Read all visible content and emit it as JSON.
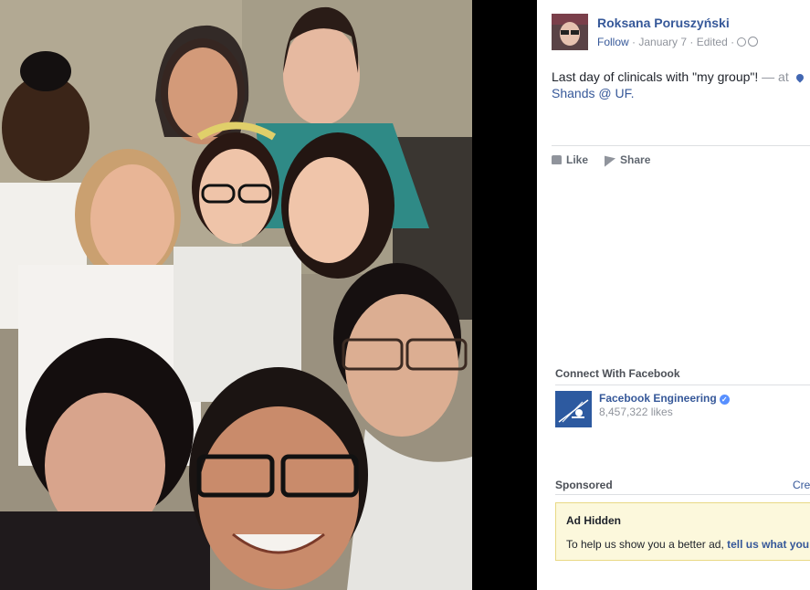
{
  "photo": {
    "alt": "Group selfie photo"
  },
  "post": {
    "author": "Roksana Poruszyński",
    "follow": "Follow",
    "date": "January 7",
    "edited": "Edited",
    "separator": " · ",
    "text": "Last day of clinicals with \"my group\"!",
    "at_prefix": " — at ",
    "place_line1": "",
    "place": "Shands @ UF."
  },
  "actions": {
    "like": "Like",
    "share": "Share"
  },
  "connect": {
    "title": "Connect With Facebook",
    "page_name": "Facebook Engineering",
    "likes": "8,457,322 likes"
  },
  "sponsored": {
    "title": "Sponsored",
    "create_link": "Cre",
    "ad_title": "Ad Hidden",
    "ad_text": "To help us show you a better ad, ",
    "ad_link": "tell us what you"
  },
  "colors": {
    "link": "#365899",
    "muted": "#90949c",
    "ad_background": "#fcf8dc"
  }
}
